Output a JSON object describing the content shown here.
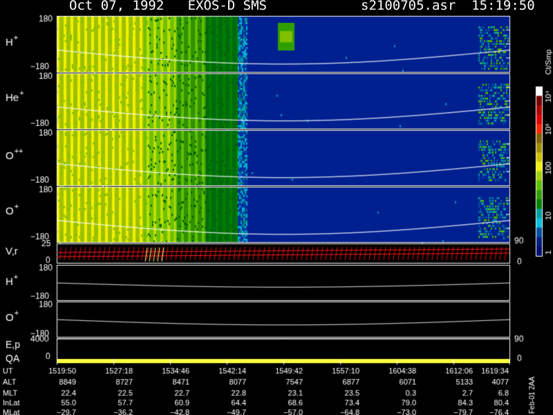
{
  "header": {
    "title_left": "Oct 07, 1992   EXOS-D SMS",
    "title_right": "s2100705.asr  15:19:50"
  },
  "colorbar": {
    "unit_label": "Ct/Smp",
    "tick_labels": [
      "10⁴",
      "10³",
      "100",
      "10",
      "1"
    ],
    "colors": [
      "#ffffff",
      "#7a0000",
      "#b00000",
      "#e00000",
      "#ff2a00",
      "#806000",
      "#a09000",
      "#d0c000",
      "#f0f000",
      "#a0d000",
      "#60c000",
      "#30a000",
      "#008000",
      "#00a0a0",
      "#00c0e0",
      "#0050a0",
      "#002080",
      "#001070"
    ]
  },
  "panels": [
    {
      "label": "H",
      "sup": "+",
      "top": "180",
      "bottom": "−180"
    },
    {
      "label": "He",
      "sup": "+",
      "top": "180",
      "bottom": "−180"
    },
    {
      "label": "O",
      "sup": "++",
      "top": "180",
      "bottom": "−180"
    },
    {
      "label": "O",
      "sup": "+",
      "top": "180",
      "bottom": "−180"
    }
  ],
  "lower_panels": {
    "vr": {
      "label": "V,r",
      "top": "25",
      "bottom": "0",
      "right_top": "90",
      "right_bottom": "0"
    },
    "h_plus": {
      "label": "H",
      "sup": "+",
      "top": "180",
      "bottom": "−180"
    },
    "o_plus": {
      "label": "O",
      "sup": "+",
      "top": "180",
      "bottom": "−180"
    },
    "ep": {
      "label": "E,p",
      "top": "4000",
      "right": "90"
    },
    "qa": {
      "label": "QA",
      "bottom": "0",
      "right_bottom": "0"
    }
  },
  "chart_data": {
    "type": "heatmap",
    "title": "Oct 07, 1992   EXOS-D SMS",
    "x_ticks": [
      "1519:50",
      "1527:18",
      "1534:46",
      "1542:14",
      "1549:42",
      "1557:10",
      "1604:38",
      "1612:06",
      "1619:34"
    ],
    "rows": [
      {
        "name": "UT",
        "values": [
          "1519:50",
          "1527:18",
          "1534:46",
          "1542:14",
          "1549:42",
          "1557:10",
          "1604:38",
          "1612:06",
          "1619:34"
        ]
      },
      {
        "name": "ALT",
        "values": [
          "8849",
          "8727",
          "8471",
          "8077",
          "7547",
          "6877",
          "6071",
          "5133",
          "4077"
        ]
      },
      {
        "name": "MLT",
        "values": [
          "22.4",
          "22.5",
          "22.7",
          "22.8",
          "23.1",
          "23.5",
          "0.3",
          "2.7",
          "6.8"
        ]
      },
      {
        "name": "InLat",
        "values": [
          "55.0",
          "57.7",
          "60.9",
          "64.4",
          "68.6",
          "73.4",
          "79.0",
          "84.3",
          "80.4"
        ]
      },
      {
        "name": "MLat",
        "values": [
          "−29.7",
          "−36.2",
          "−42.8",
          "−49.7",
          "−57.0",
          "−64.8",
          "−73.0",
          "−79.7",
          "−76.4"
        ]
      }
    ],
    "pitch_angle_range": [
      -180,
      180
    ],
    "colorbar_range_ct_per_smp": [
      1,
      10000
    ],
    "colorbar_scale": "log",
    "side_note": "Feb-01 2AA"
  }
}
